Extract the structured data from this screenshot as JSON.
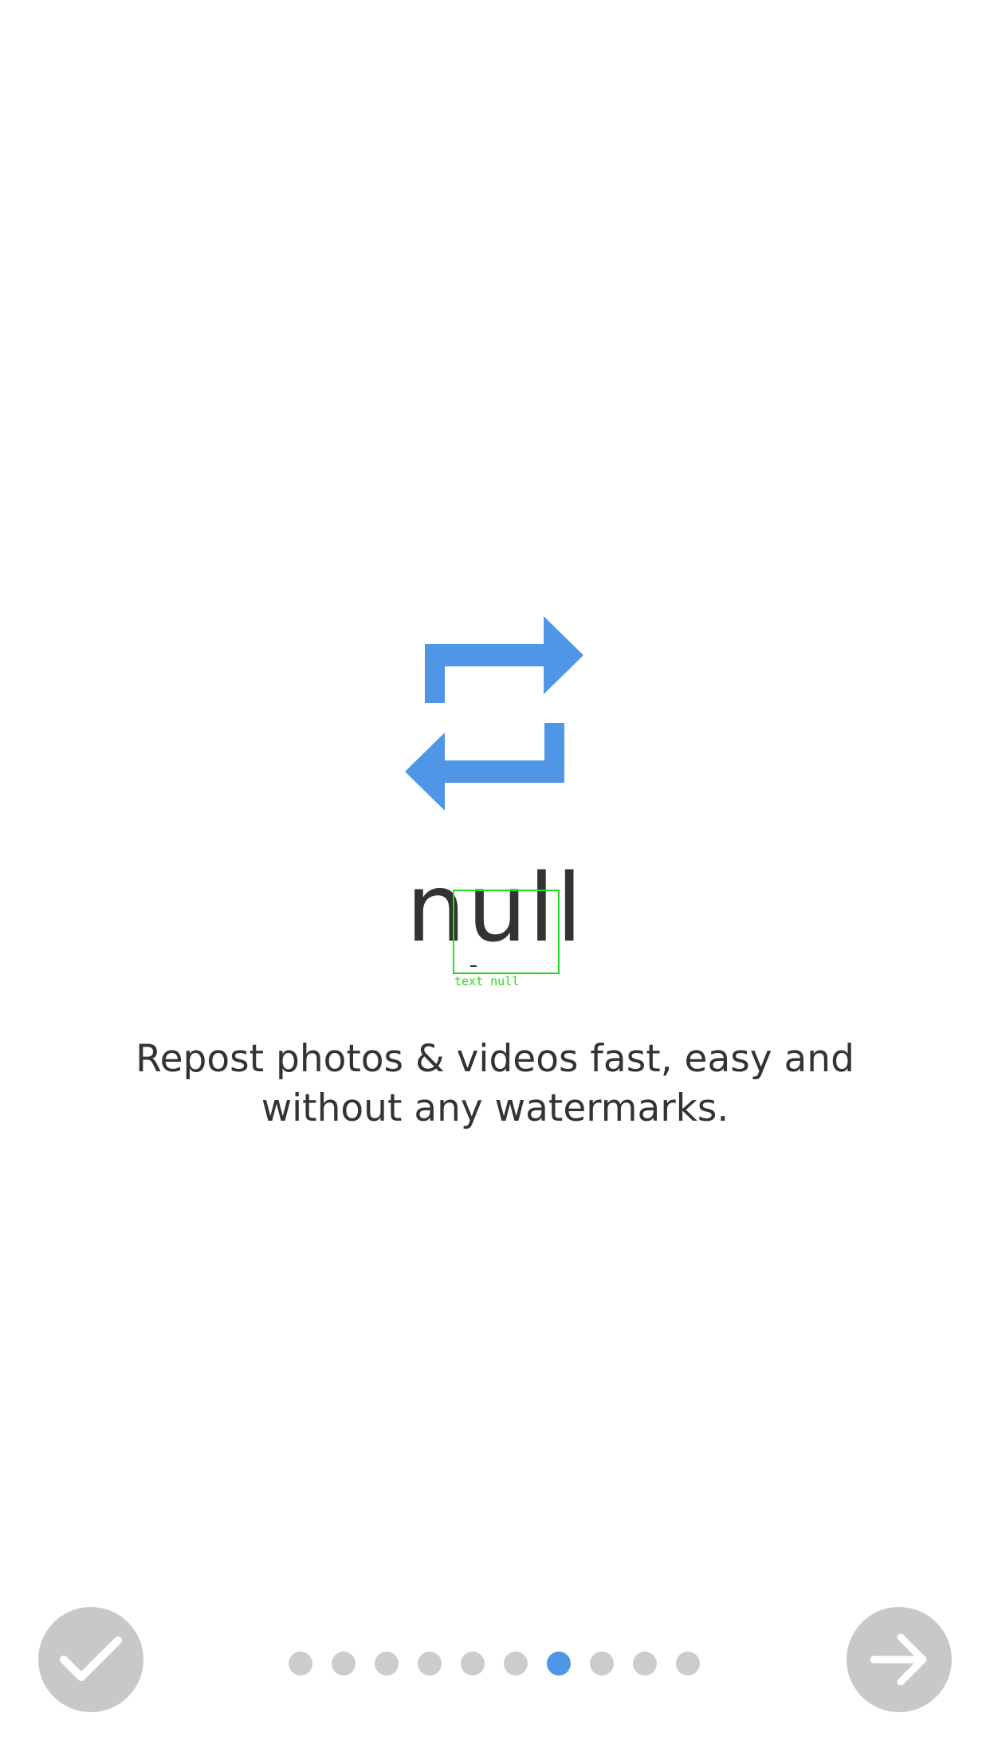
{
  "onboarding": {
    "title": "null",
    "description": "Repost photos & videos fast, easy and without any watermarks.",
    "accent_color": "#5096e6",
    "icon": "repost-icon"
  },
  "debug_overlay": {
    "label": "text null"
  },
  "navigation": {
    "done_icon": "checkmark-icon",
    "next_icon": "arrow-right-icon"
  },
  "pager": {
    "total": 10,
    "active_index": 6,
    "active_color": "#5096e6",
    "inactive_color": "#cccccc"
  }
}
